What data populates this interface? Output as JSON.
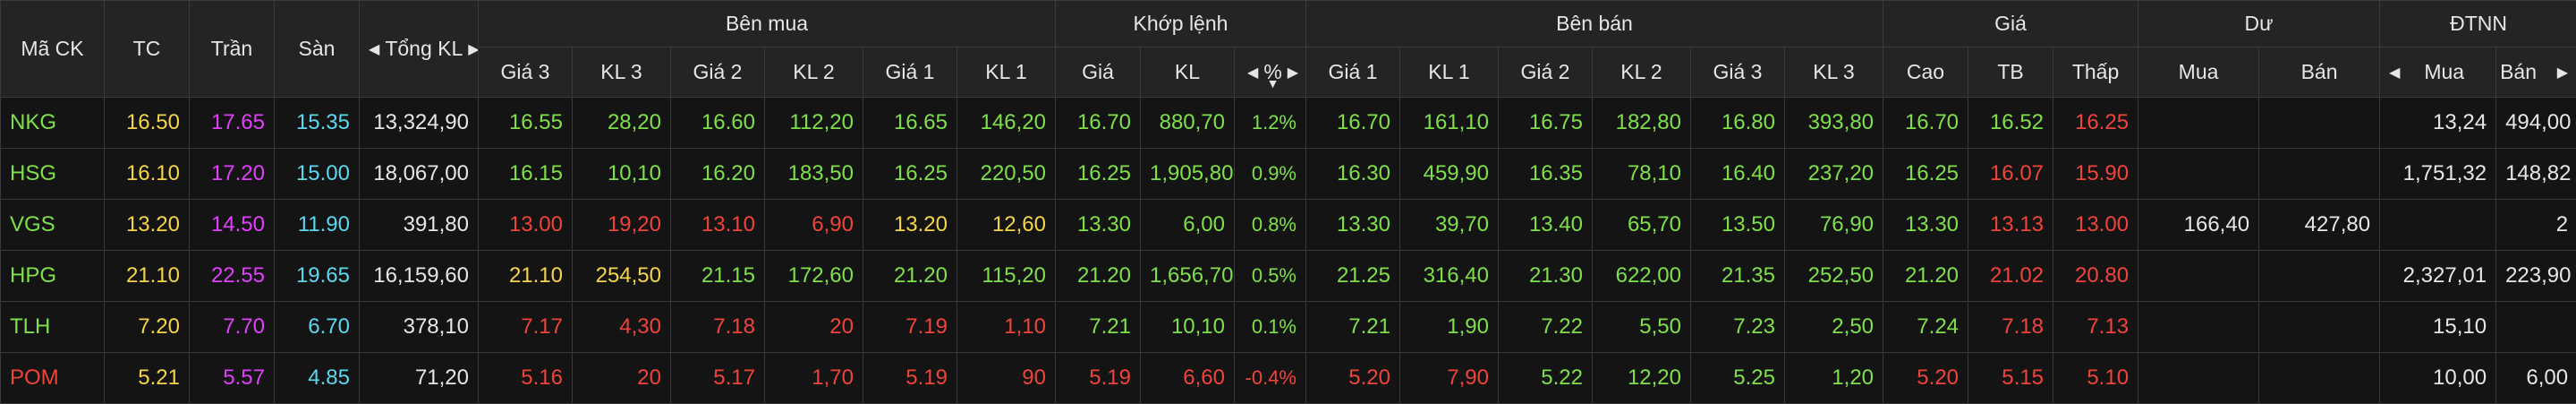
{
  "colors": {
    "ceiling": "#e040fb",
    "floor": "#5ad8f0",
    "reference": "#f5d547",
    "up": "#7ee04a",
    "down": "#f0443a",
    "neutral": "#e6e6e6"
  },
  "header": {
    "symbol": "Mã CK",
    "ref": "TC",
    "ceil": "Trần",
    "floor": "Sàn",
    "total_volume": "Tổng KL",
    "buy_group": "Bên mua",
    "match_group": "Khớp lệnh",
    "sell_group": "Bên bán",
    "price_group": "Giá",
    "remain_group": "Dư",
    "foreign_group": "ĐTNN",
    "gia3": "Giá 3",
    "kl3": "KL 3",
    "gia2": "Giá 2",
    "kl2": "KL 2",
    "gia1": "Giá 1",
    "kl1": "KL 1",
    "gia": "Giá",
    "kl": "KL",
    "pct": "%",
    "high": "Cao",
    "avg": "TB",
    "low": "Thấp",
    "mua": "Mua",
    "ban": "Bán",
    "f_mua": "Mua",
    "f_ban": "Bán"
  },
  "rows": [
    {
      "symbol": "NKG",
      "ref": "16.50",
      "ceil": "17.65",
      "floor": "15.35",
      "total": "13,324,90",
      "b3p": "16.55",
      "b3v": "28,20",
      "b2p": "16.60",
      "b2v": "112,20",
      "b1p": "16.65",
      "b1v": "146,20",
      "mp": "16.70",
      "mv": "880,70",
      "pct": "1.2%",
      "s1p": "16.70",
      "s1v": "161,10",
      "s2p": "16.75",
      "s2v": "182,80",
      "s3p": "16.80",
      "s3v": "393,80",
      "high": "16.70",
      "avg": "16.52",
      "low": "16.25",
      "rmua": "",
      "rban": "",
      "fmua": "13,24",
      "fban": "494,00",
      "c": {
        "sym": "up",
        "b3": "up",
        "b2": "up",
        "b1": "up",
        "m": "up",
        "s1": "up",
        "s2": "up",
        "s3": "up",
        "high": "up",
        "avg": "up",
        "low": "down"
      }
    },
    {
      "symbol": "HSG",
      "ref": "16.10",
      "ceil": "17.20",
      "floor": "15.00",
      "total": "18,067,00",
      "b3p": "16.15",
      "b3v": "10,10",
      "b2p": "16.20",
      "b2v": "183,50",
      "b1p": "16.25",
      "b1v": "220,50",
      "mp": "16.25",
      "mv": "1,905,80",
      "pct": "0.9%",
      "s1p": "16.30",
      "s1v": "459,90",
      "s2p": "16.35",
      "s2v": "78,10",
      "s3p": "16.40",
      "s3v": "237,20",
      "high": "16.25",
      "avg": "16.07",
      "low": "15.90",
      "rmua": "",
      "rban": "",
      "fmua": "1,751,32",
      "fban": "148,82",
      "c": {
        "sym": "up",
        "b3": "up",
        "b2": "up",
        "b1": "up",
        "m": "up",
        "s1": "up",
        "s2": "up",
        "s3": "up",
        "high": "up",
        "avg": "down",
        "low": "down"
      }
    },
    {
      "symbol": "VGS",
      "ref": "13.20",
      "ceil": "14.50",
      "floor": "11.90",
      "total": "391,80",
      "b3p": "13.00",
      "b3v": "19,20",
      "b2p": "13.10",
      "b2v": "6,90",
      "b1p": "13.20",
      "b1v": "12,60",
      "mp": "13.30",
      "mv": "6,00",
      "pct": "0.8%",
      "s1p": "13.30",
      "s1v": "39,70",
      "s2p": "13.40",
      "s2v": "65,70",
      "s3p": "13.50",
      "s3v": "76,90",
      "high": "13.30",
      "avg": "13.13",
      "low": "13.00",
      "rmua": "166,40",
      "rban": "427,80",
      "fmua": "",
      "fban": "2",
      "c": {
        "sym": "up",
        "b3": "down",
        "b2": "down",
        "b1": "ref",
        "m": "up",
        "s1": "up",
        "s2": "up",
        "s3": "up",
        "high": "up",
        "avg": "down",
        "low": "down"
      }
    },
    {
      "symbol": "HPG",
      "ref": "21.10",
      "ceil": "22.55",
      "floor": "19.65",
      "total": "16,159,60",
      "b3p": "21.10",
      "b3v": "254,50",
      "b2p": "21.15",
      "b2v": "172,60",
      "b1p": "21.20",
      "b1v": "115,20",
      "mp": "21.20",
      "mv": "1,656,70",
      "pct": "0.5%",
      "s1p": "21.25",
      "s1v": "316,40",
      "s2p": "21.30",
      "s2v": "622,00",
      "s3p": "21.35",
      "s3v": "252,50",
      "high": "21.20",
      "avg": "21.02",
      "low": "20.80",
      "rmua": "",
      "rban": "",
      "fmua": "2,327,01",
      "fban": "223,90",
      "c": {
        "sym": "up",
        "b3": "ref",
        "b2": "up",
        "b1": "up",
        "m": "up",
        "s1": "up",
        "s2": "up",
        "s3": "up",
        "high": "up",
        "avg": "down",
        "low": "down"
      }
    },
    {
      "symbol": "TLH",
      "ref": "7.20",
      "ceil": "7.70",
      "floor": "6.70",
      "total": "378,10",
      "b3p": "7.17",
      "b3v": "4,30",
      "b2p": "7.18",
      "b2v": "20",
      "b1p": "7.19",
      "b1v": "1,10",
      "mp": "7.21",
      "mv": "10,10",
      "pct": "0.1%",
      "s1p": "7.21",
      "s1v": "1,90",
      "s2p": "7.22",
      "s2v": "5,50",
      "s3p": "7.23",
      "s3v": "2,50",
      "high": "7.24",
      "avg": "7.18",
      "low": "7.13",
      "rmua": "",
      "rban": "",
      "fmua": "15,10",
      "fban": "",
      "c": {
        "sym": "up",
        "b3": "down",
        "b2": "down",
        "b1": "down",
        "m": "up",
        "s1": "up",
        "s2": "up",
        "s3": "up",
        "high": "up",
        "avg": "down",
        "low": "down"
      }
    },
    {
      "symbol": "POM",
      "ref": "5.21",
      "ceil": "5.57",
      "floor": "4.85",
      "total": "71,20",
      "b3p": "5.16",
      "b3v": "20",
      "b2p": "5.17",
      "b2v": "1,70",
      "b1p": "5.19",
      "b1v": "90",
      "mp": "5.19",
      "mv": "6,60",
      "pct": "-0.4%",
      "s1p": "5.20",
      "s1v": "7,90",
      "s2p": "5.22",
      "s2v": "12,20",
      "s3p": "5.25",
      "s3v": "1,20",
      "high": "5.20",
      "avg": "5.15",
      "low": "5.10",
      "rmua": "",
      "rban": "",
      "fmua": "10,00",
      "fban": "6,00",
      "c": {
        "sym": "down",
        "b3": "down",
        "b2": "down",
        "b1": "down",
        "m": "down",
        "s1": "down",
        "s2": "up",
        "s3": "up",
        "high": "down",
        "avg": "down",
        "low": "down"
      }
    }
  ]
}
